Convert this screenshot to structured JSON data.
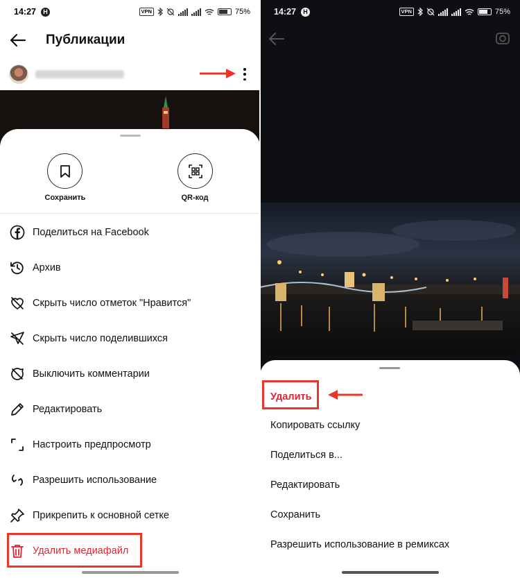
{
  "left": {
    "status": {
      "time": "14:27",
      "badge": "H",
      "vpn": "VPN",
      "battery": "75%"
    },
    "header": {
      "title": "Публикации"
    },
    "actions": [
      {
        "label": "Сохранить",
        "icon": "bookmark-icon"
      },
      {
        "label": "QR-код",
        "icon": "qr-code-icon"
      }
    ],
    "menu": [
      {
        "label": "Поделиться на Facebook",
        "icon": "facebook-icon"
      },
      {
        "label": "Архив",
        "icon": "archive-history-icon"
      },
      {
        "label": "Скрыть число отметок \"Нравится\"",
        "icon": "heart-off-icon"
      },
      {
        "label": "Скрыть число поделившихся",
        "icon": "share-off-icon"
      },
      {
        "label": "Выключить комментарии",
        "icon": "comment-off-icon"
      },
      {
        "label": "Редактировать",
        "icon": "pencil-icon"
      },
      {
        "label": "Настроить предпросмотр",
        "icon": "crop-icon"
      },
      {
        "label": "Разрешить использование",
        "icon": "remix-icon"
      },
      {
        "label": "Прикрепить к основной сетке",
        "icon": "pin-icon"
      },
      {
        "label": "Удалить медиафайл",
        "icon": "trash-icon",
        "danger": true
      }
    ]
  },
  "right": {
    "status": {
      "time": "14:27",
      "badge": "H",
      "vpn": "VPN",
      "battery": "75%"
    },
    "menu": [
      {
        "label": "Удалить",
        "danger": true
      },
      {
        "label": "Копировать ссылку"
      },
      {
        "label": "Поделиться в..."
      },
      {
        "label": "Редактировать"
      },
      {
        "label": "Сохранить"
      },
      {
        "label": "Разрешить использование в ремиксах"
      }
    ]
  },
  "colors": {
    "danger": "#e0242f",
    "highlight": "#e8362a",
    "dark_bg": "#0d0f12"
  }
}
